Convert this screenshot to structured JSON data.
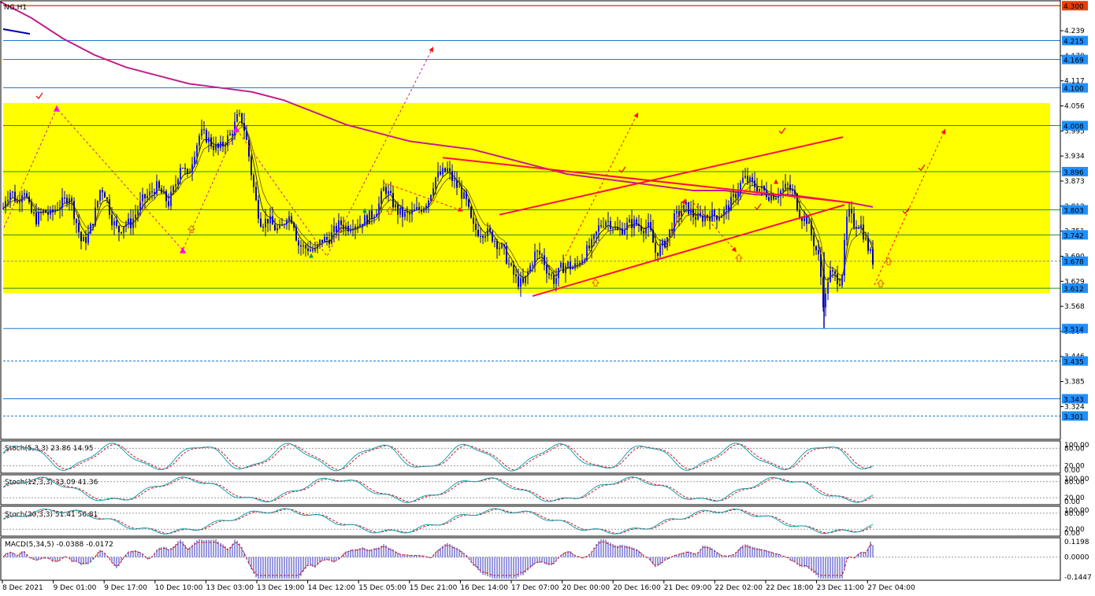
{
  "symbol_label": "NG,H1",
  "colors": {
    "background": "#ffffff",
    "zone_fill": "#ffff00",
    "bull_candle": "#1c1cff",
    "bear_candle": "#0000aa",
    "ma_slow": "#c0208a",
    "ma_fast1": "#333300",
    "ma_fast2": "#807000",
    "level_line": "#1e78d2",
    "top_line": "#e8400a",
    "trend_line": "#ff1040",
    "arrow": "#ff1010",
    "magenta": "#ff00ff",
    "price_label_bg": "#1e90ff",
    "stoch_main": "#14a0b4",
    "stoch_signal": "#d21414",
    "macd_hist": "#3030c0",
    "macd_signal": "#d21414"
  },
  "chart_data": [
    {
      "type": "candlestick",
      "symbol": "NG,H1",
      "ylim": [
        3.25,
        4.31
      ],
      "price_ticks": [
        "4.239",
        "4.178",
        "4.117",
        "4.056",
        "3.995",
        "3.934",
        "3.873",
        "3.812",
        "3.751",
        "3.690",
        "3.629",
        "3.568",
        "3.507",
        "3.446",
        "3.385",
        "3.324"
      ],
      "levels": [
        {
          "value": 4.3,
          "label": "4.300",
          "style": "solid",
          "color": "#e8400a"
        },
        {
          "value": 4.215,
          "label": "4.215",
          "style": "solid",
          "color": "#1e78d2"
        },
        {
          "value": 4.169,
          "label": "4.169",
          "style": "solid",
          "color": "#1e78d2"
        },
        {
          "value": 4.1,
          "label": "4.100",
          "style": "solid",
          "color": "#1e78d2"
        },
        {
          "value": 4.008,
          "label": "4.008",
          "style": "solid",
          "color": "#2a8a2a"
        },
        {
          "value": 3.896,
          "label": "3.896",
          "style": "solid",
          "color": "#2a8a2a"
        },
        {
          "value": 3.803,
          "label": "3.803",
          "style": "solid",
          "color": "#2a8a2a"
        },
        {
          "value": 3.742,
          "label": "3.742",
          "style": "solid",
          "color": "#2a8a2a"
        },
        {
          "value": 3.678,
          "label": "3.678",
          "style": "dashed",
          "color": "#8a8a8a"
        },
        {
          "value": 3.612,
          "label": "3.612",
          "style": "solid",
          "color": "#2a8a2a"
        },
        {
          "value": 3.514,
          "label": "3.514",
          "style": "solid",
          "color": "#1e78d2"
        },
        {
          "value": 3.435,
          "label": "3.435",
          "style": "dashed",
          "color": "#1e78d2"
        },
        {
          "value": 3.343,
          "label": "3.343",
          "style": "solid",
          "color": "#1e78d2"
        },
        {
          "value": 3.301,
          "label": "3.301",
          "style": "dashed",
          "color": "#1e78d2"
        }
      ],
      "zone": {
        "from": 3.6,
        "to": 4.063
      },
      "x_labels": [
        "8 Dec 2021",
        "9 Dec 01:00",
        "9 Dec 17:00",
        "10 Dec 10:00",
        "13 Dec 03:00",
        "13 Dec 19:00",
        "14 Dec 12:00",
        "15 Dec 05:00",
        "15 Dec 21:00",
        "16 Dec 14:00",
        "17 Dec 07:00",
        "20 Dec 00:00",
        "20 Dec 16:00",
        "21 Dec 09:00",
        "22 Dec 02:00",
        "22 Dec 18:00",
        "23 Dec 11:00",
        "27 Dec 04:00"
      ],
      "close_path": [
        [
          0,
          3.76
        ],
        [
          6,
          3.83
        ],
        [
          14,
          3.85
        ],
        [
          22,
          3.82
        ],
        [
          30,
          3.86
        ],
        [
          38,
          3.8
        ],
        [
          46,
          3.78
        ],
        [
          56,
          3.8
        ],
        [
          64,
          3.79
        ],
        [
          72,
          3.81
        ],
        [
          80,
          3.82
        ],
        [
          88,
          3.84
        ],
        [
          96,
          3.78
        ],
        [
          104,
          3.72
        ],
        [
          112,
          3.74
        ],
        [
          120,
          3.79
        ],
        [
          128,
          3.86
        ],
        [
          134,
          3.84
        ],
        [
          142,
          3.78
        ],
        [
          150,
          3.75
        ],
        [
          158,
          3.77
        ],
        [
          166,
          3.77
        ],
        [
          174,
          3.8
        ],
        [
          182,
          3.83
        ],
        [
          190,
          3.84
        ],
        [
          198,
          3.86
        ],
        [
          206,
          3.84
        ],
        [
          214,
          3.82
        ],
        [
          222,
          3.86
        ],
        [
          230,
          3.92
        ],
        [
          238,
          3.88
        ],
        [
          246,
          3.94
        ],
        [
          254,
          3.99
        ],
        [
          262,
          3.98
        ],
        [
          270,
          3.96
        ],
        [
          278,
          3.95
        ],
        [
          286,
          3.97
        ],
        [
          294,
          3.99
        ],
        [
          302,
          4.03
        ],
        [
          308,
          4.02
        ],
        [
          314,
          3.96
        ],
        [
          320,
          3.88
        ],
        [
          326,
          3.81
        ],
        [
          332,
          3.77
        ],
        [
          340,
          3.78
        ],
        [
          348,
          3.76
        ],
        [
          356,
          3.75
        ],
        [
          364,
          3.79
        ],
        [
          372,
          3.78
        ],
        [
          378,
          3.72
        ],
        [
          386,
          3.71
        ],
        [
          392,
          3.71
        ],
        [
          400,
          3.7
        ],
        [
          408,
          3.73
        ],
        [
          416,
          3.73
        ],
        [
          424,
          3.75
        ],
        [
          432,
          3.77
        ],
        [
          440,
          3.76
        ],
        [
          448,
          3.77
        ],
        [
          456,
          3.77
        ],
        [
          464,
          3.78
        ],
        [
          472,
          3.79
        ],
        [
          480,
          3.81
        ],
        [
          488,
          3.86
        ],
        [
          496,
          3.83
        ],
        [
          504,
          3.8
        ],
        [
          512,
          3.79
        ],
        [
          520,
          3.79
        ],
        [
          528,
          3.8
        ],
        [
          536,
          3.81
        ],
        [
          544,
          3.83
        ],
        [
          552,
          3.88
        ],
        [
          560,
          3.89
        ],
        [
          568,
          3.9
        ],
        [
          576,
          3.87
        ],
        [
          584,
          3.85
        ],
        [
          592,
          3.82
        ],
        [
          600,
          3.76
        ],
        [
          608,
          3.75
        ],
        [
          616,
          3.75
        ],
        [
          624,
          3.74
        ],
        [
          632,
          3.72
        ],
        [
          640,
          3.7
        ],
        [
          648,
          3.66
        ],
        [
          656,
          3.63
        ],
        [
          664,
          3.62
        ],
        [
          672,
          3.66
        ],
        [
          680,
          3.7
        ],
        [
          688,
          3.69
        ],
        [
          696,
          3.65
        ],
        [
          704,
          3.63
        ],
        [
          712,
          3.66
        ],
        [
          720,
          3.67
        ],
        [
          728,
          3.66
        ],
        [
          736,
          3.68
        ],
        [
          744,
          3.7
        ],
        [
          752,
          3.72
        ],
        [
          760,
          3.76
        ],
        [
          768,
          3.78
        ],
        [
          776,
          3.77
        ],
        [
          784,
          3.75
        ],
        [
          792,
          3.76
        ],
        [
          800,
          3.77
        ],
        [
          808,
          3.77
        ],
        [
          816,
          3.76
        ],
        [
          824,
          3.76
        ],
        [
          832,
          3.7
        ],
        [
          840,
          3.71
        ],
        [
          848,
          3.74
        ],
        [
          856,
          3.78
        ],
        [
          864,
          3.8
        ],
        [
          872,
          3.81
        ],
        [
          880,
          3.79
        ],
        [
          888,
          3.78
        ],
        [
          896,
          3.79
        ],
        [
          904,
          3.79
        ],
        [
          912,
          3.79
        ],
        [
          920,
          3.8
        ],
        [
          928,
          3.82
        ],
        [
          936,
          3.85
        ],
        [
          944,
          3.88
        ],
        [
          952,
          3.87
        ],
        [
          960,
          3.86
        ],
        [
          968,
          3.85
        ],
        [
          976,
          3.84
        ],
        [
          984,
          3.84
        ],
        [
          992,
          3.85
        ],
        [
          1000,
          3.86
        ],
        [
          1008,
          3.84
        ],
        [
          1016,
          3.79
        ],
        [
          1024,
          3.78
        ],
        [
          1032,
          3.73
        ],
        [
          1040,
          3.68
        ],
        [
          1046,
          3.56
        ],
        [
          1052,
          3.65
        ],
        [
          1060,
          3.64
        ],
        [
          1068,
          3.63
        ],
        [
          1076,
          3.8
        ],
        [
          1084,
          3.77
        ],
        [
          1092,
          3.77
        ],
        [
          1100,
          3.72
        ],
        [
          1108,
          3.68
        ]
      ],
      "ma_slow": [
        [
          0,
          4.31
        ],
        [
          40,
          4.27
        ],
        [
          80,
          4.22
        ],
        [
          120,
          4.18
        ],
        [
          160,
          4.15
        ],
        [
          200,
          4.13
        ],
        [
          240,
          4.11
        ],
        [
          280,
          4.1
        ],
        [
          320,
          4.09
        ],
        [
          360,
          4.07
        ],
        [
          400,
          4.04
        ],
        [
          440,
          4.01
        ],
        [
          480,
          3.99
        ],
        [
          520,
          3.97
        ],
        [
          560,
          3.96
        ],
        [
          600,
          3.95
        ],
        [
          640,
          3.93
        ],
        [
          680,
          3.91
        ],
        [
          720,
          3.89
        ],
        [
          760,
          3.88
        ],
        [
          800,
          3.87
        ],
        [
          840,
          3.86
        ],
        [
          880,
          3.85
        ],
        [
          920,
          3.85
        ],
        [
          960,
          3.84
        ],
        [
          1000,
          3.84
        ],
        [
          1040,
          3.83
        ],
        [
          1080,
          3.82
        ],
        [
          1108,
          3.81
        ]
      ],
      "trend_lines": [
        [
          [
            562,
            3.93
          ],
          [
            1082,
            3.82
          ]
        ],
        [
          [
            634,
            3.791
          ],
          [
            1070,
            3.98
          ]
        ],
        [
          [
            676,
            3.593
          ],
          [
            1072,
            3.815
          ]
        ]
      ],
      "dashed_paths": [
        [
          [
            5,
            3.76
          ],
          [
            72,
            4.05
          ],
          [
            232,
            3.705
          ],
          [
            300,
            4.0
          ],
          [
            415,
            3.69
          ],
          [
            550,
            4.2
          ]
        ],
        [
          [
            715,
            3.68
          ],
          [
            810,
            4.04
          ]
        ],
        [
          [
            845,
            3.71
          ],
          [
            870,
            3.83
          ]
        ],
        [
          [
            880,
            3.82
          ],
          [
            935,
            3.7
          ]
        ],
        [
          [
            1110,
            3.62
          ],
          [
            1200,
            4.0
          ]
        ],
        [
          [
            486,
            3.87
          ],
          [
            588,
            3.8
          ]
        ]
      ]
    },
    {
      "type": "line",
      "title": "Stoch(5,3,3) 23.86 14.95",
      "ylim": [
        0,
        100
      ],
      "tick_labels": [
        "100.00",
        "80.00",
        "20.00",
        "0.00"
      ],
      "series": [
        {
          "name": "main",
          "values": [
            23.86
          ]
        },
        {
          "name": "signal",
          "values": [
            14.95
          ]
        }
      ]
    },
    {
      "type": "line",
      "title": "Stoch(12,3,3) 33.09 41.36",
      "ylim": [
        0,
        100
      ],
      "tick_labels": [
        "100.00",
        "80.00",
        "20.00",
        "0.00"
      ],
      "series": [
        {
          "name": "main",
          "values": [
            33.09
          ]
        },
        {
          "name": "signal",
          "values": [
            41.36
          ]
        }
      ]
    },
    {
      "type": "line",
      "title": "Stoch(20,3,3) 51.41 56.81",
      "ylim": [
        0,
        100
      ],
      "tick_labels": [
        "100.00",
        "80.00",
        "20.00",
        "0.00"
      ],
      "series": [
        {
          "name": "main",
          "values": [
            51.41
          ]
        },
        {
          "name": "signal",
          "values": [
            56.81
          ]
        }
      ]
    },
    {
      "type": "bar",
      "title": "MACD(5,34,5) -0.0388 -0.0172",
      "ylim": [
        -0.1447,
        0.1198
      ],
      "tick_labels": [
        "0.1198",
        "0.0000",
        "-0.1447"
      ],
      "series": [
        {
          "name": "macd",
          "values": [
            -0.0388
          ]
        },
        {
          "name": "signal",
          "values": [
            -0.0172
          ]
        }
      ]
    }
  ]
}
